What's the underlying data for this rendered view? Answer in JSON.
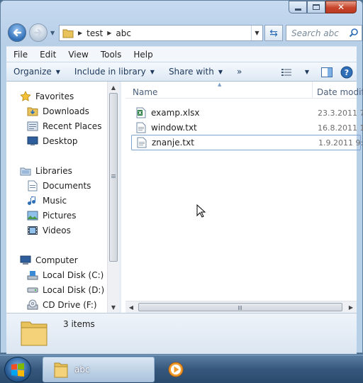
{
  "address": {
    "crumbs": [
      "test",
      "abc"
    ]
  },
  "search": {
    "placeholder": "Search abc"
  },
  "menu": [
    "File",
    "Edit",
    "View",
    "Tools",
    "Help"
  ],
  "toolbar": {
    "organize": "Organize",
    "include_in_library": "Include in library",
    "share_with": "Share with",
    "more": "»"
  },
  "navigation": {
    "favorites": {
      "label": "Favorites",
      "items": [
        "Downloads",
        "Recent Places",
        "Desktop"
      ]
    },
    "libraries": {
      "label": "Libraries",
      "items": [
        "Documents",
        "Music",
        "Pictures",
        "Videos"
      ]
    },
    "computer": {
      "label": "Computer",
      "items": [
        "Local Disk (C:)",
        "Local Disk (D:)",
        "CD Drive (F:)"
      ]
    }
  },
  "columns": {
    "name": "Name",
    "date": "Date modif"
  },
  "files": [
    {
      "name": "examp.xlsx",
      "date": "23.3.2011 7",
      "icon": "excel-file-icon"
    },
    {
      "name": "window.txt",
      "date": "16.8.2011 1",
      "icon": "text-file-icon"
    },
    {
      "name": "znanje.txt",
      "date": "1.9.2011 9:3",
      "icon": "text-file-icon"
    }
  ],
  "details": {
    "count": "3 items"
  },
  "taskbar": {
    "explorer_label": "abc"
  },
  "colors": {
    "accent": "#2f6fb8",
    "selection_border": "#7da2ce",
    "close_red": "#c7442b"
  }
}
